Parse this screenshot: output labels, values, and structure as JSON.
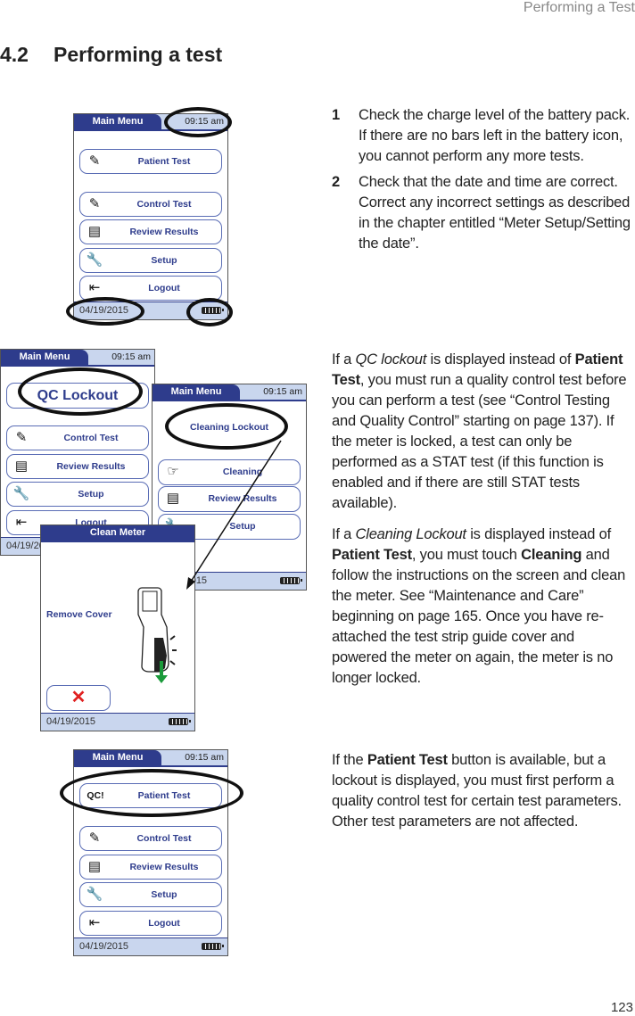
{
  "running_header": "Performing a Test",
  "section": {
    "number": "4.2",
    "title": "Performing a test"
  },
  "page_number": "123",
  "steps": [
    {
      "n": "1",
      "text": "Check the charge level of the battery pack. If there are no bars left in the battery icon, you cannot perform any more tests."
    },
    {
      "n": "2",
      "text": "Check that the date and time are correct. Correct any incorrect settings as described in the chapter entitled “Meter Setup/Setting the date”."
    }
  ],
  "para_qc": {
    "a": "If a ",
    "b": "QC lockout",
    "c": " is displayed instead of ",
    "d": "Patient Test",
    "e": ", you must run a quality control test before you can perform a test (see “Control Testing and Quality Control” starting on page 137). If the meter is locked, a test can only be performed as a STAT test (if this function is enabled and if there are still STAT tests available)."
  },
  "para_clean": {
    "a": "If a ",
    "b": "Cleaning Lockout",
    "c": " is displayed instead of ",
    "d": "Patient Test",
    "e": ", you must touch ",
    "f": "Cleaning",
    "g": " and follow the instructions on the screen and clean the meter. See “Maintenance and Care” beginning on page 165. Once you have re-attached the test strip guide cover and powered the meter on again, the  meter is no longer locked."
  },
  "para_patient": {
    "a": "If the ",
    "b": "Patient Test",
    "c": " button is available, but a lockout is displayed, you must first perform a quality control test for certain test parameters. Other test parameters are not affected."
  },
  "screen": {
    "main_menu": "Main Menu",
    "time": "09:15 am",
    "date": "04/19/2015",
    "patient_test": "Patient Test",
    "control_test": "Control Test",
    "review_results": "Review Results",
    "setup": "Setup",
    "logout": "Logout",
    "qc_lockout": "QC Lockout",
    "cleaning_lockout": "Cleaning Lockout",
    "cleaning": "Cleaning",
    "clean_meter": "Clean Meter",
    "remove_cover": "Remove Cover",
    "qc_badge": "QC!",
    "battery_level": 1.0
  },
  "colors": {
    "header": "#2e3c8c",
    "bar": "#c9d6ee",
    "cancel": "#e02020",
    "arrow": "#1a9a3a"
  }
}
